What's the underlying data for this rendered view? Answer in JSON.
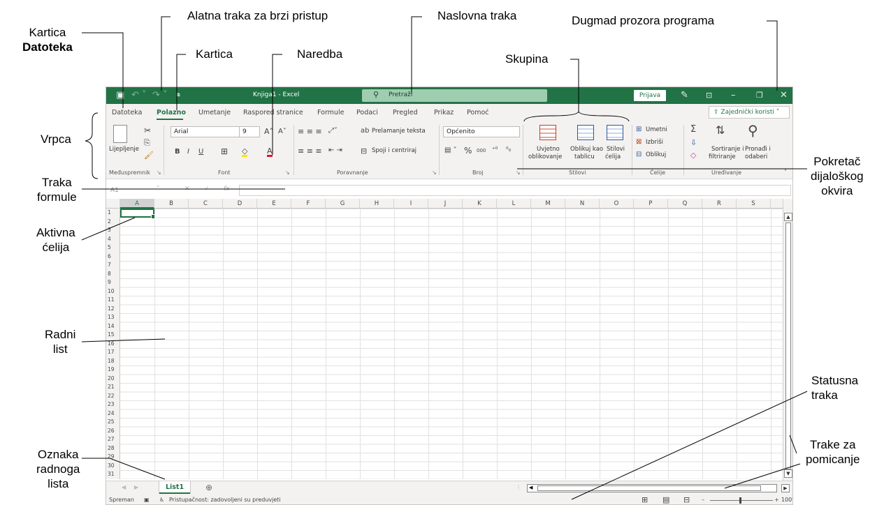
{
  "annotations": {
    "kartica_datoteka_line1": "Kartica",
    "kartica_datoteka_line2": "Datoteka",
    "quick_access": "Alatna traka za brzi pristup",
    "title_bar": "Naslovna traka",
    "window_buttons": "Dugmad prozora programa",
    "kartica": "Kartica",
    "naredba": "Naredba",
    "skupina": "Skupina",
    "vrpca": "Vrpca",
    "dialog_launcher_1": "Pokretač",
    "dialog_launcher_2": "dijaloškog",
    "dialog_launcher_3": "okvira",
    "formula_bar_1": "Traka",
    "formula_bar_2": "formule",
    "active_cell_1": "Aktivna",
    "active_cell_2": "ćelija",
    "worksheet_1": "Radni",
    "worksheet_2": "list",
    "status_bar_1": "Statusna",
    "status_bar_2": "traka",
    "scroll_bars_1": "Trake za",
    "scroll_bars_2": "pomicanje",
    "sheet_tab_1": "Oznaka",
    "sheet_tab_2": "radnoga",
    "sheet_tab_3": "lista"
  },
  "window": {
    "title": "Knjiga1  -  Excel",
    "search_placeholder": "Pretraži",
    "sign_in": "Prijava",
    "share": "Zajednički koristi"
  },
  "tabs": [
    "Datoteka",
    "Polazno",
    "Umetanje",
    "Raspored stranice",
    "Formule",
    "Podaci",
    "Pregled",
    "Prikaz",
    "Pomoć"
  ],
  "ribbon": {
    "paste": "Lijepljenje",
    "clipboard": "Međuspremnik",
    "font_name": "Arial",
    "font_size": "9",
    "font_group": "Font",
    "wrap_text": "Prelamanje teksta",
    "merge_center": "Spoji i centriraj",
    "alignment": "Poravnanje",
    "number_format": "Općenito",
    "number": "Broj",
    "conditional_1": "Uvjetno",
    "conditional_2": "oblikovanje",
    "format_table_1": "Oblikuj kao",
    "format_table_2": "tablicu",
    "cell_styles_1": "Stilovi",
    "cell_styles_2": "ćelija",
    "styles": "Stilovi",
    "insert": "Umetni",
    "delete": "Izbriši",
    "format": "Oblikuj",
    "cells": "Ćelije",
    "sort_1": "Sortiranje i",
    "sort_2": "filtriranje",
    "find_1": "Pronađi i",
    "find_2": "odaberi",
    "editing": "Uređivanje"
  },
  "formula_bar": {
    "name_box": "A1",
    "fx": "fx"
  },
  "columns": [
    "A",
    "B",
    "C",
    "D",
    "E",
    "F",
    "G",
    "H",
    "I",
    "J",
    "K",
    "L",
    "M",
    "N",
    "O",
    "P",
    "Q",
    "R",
    "S"
  ],
  "rows": [
    "1",
    "2",
    "3",
    "4",
    "5",
    "6",
    "7",
    "8",
    "9",
    "10",
    "11",
    "12",
    "13",
    "14",
    "15",
    "16",
    "17",
    "18",
    "19",
    "20",
    "21",
    "22",
    "23",
    "24",
    "25",
    "26",
    "27",
    "28",
    "29",
    "30",
    "31"
  ],
  "sheet": {
    "tab": "List1"
  },
  "status": {
    "ready": "Spreman",
    "accessibility": "Pristupačnost: zadovoljeni su preduvjeti",
    "zoom": "100%"
  }
}
